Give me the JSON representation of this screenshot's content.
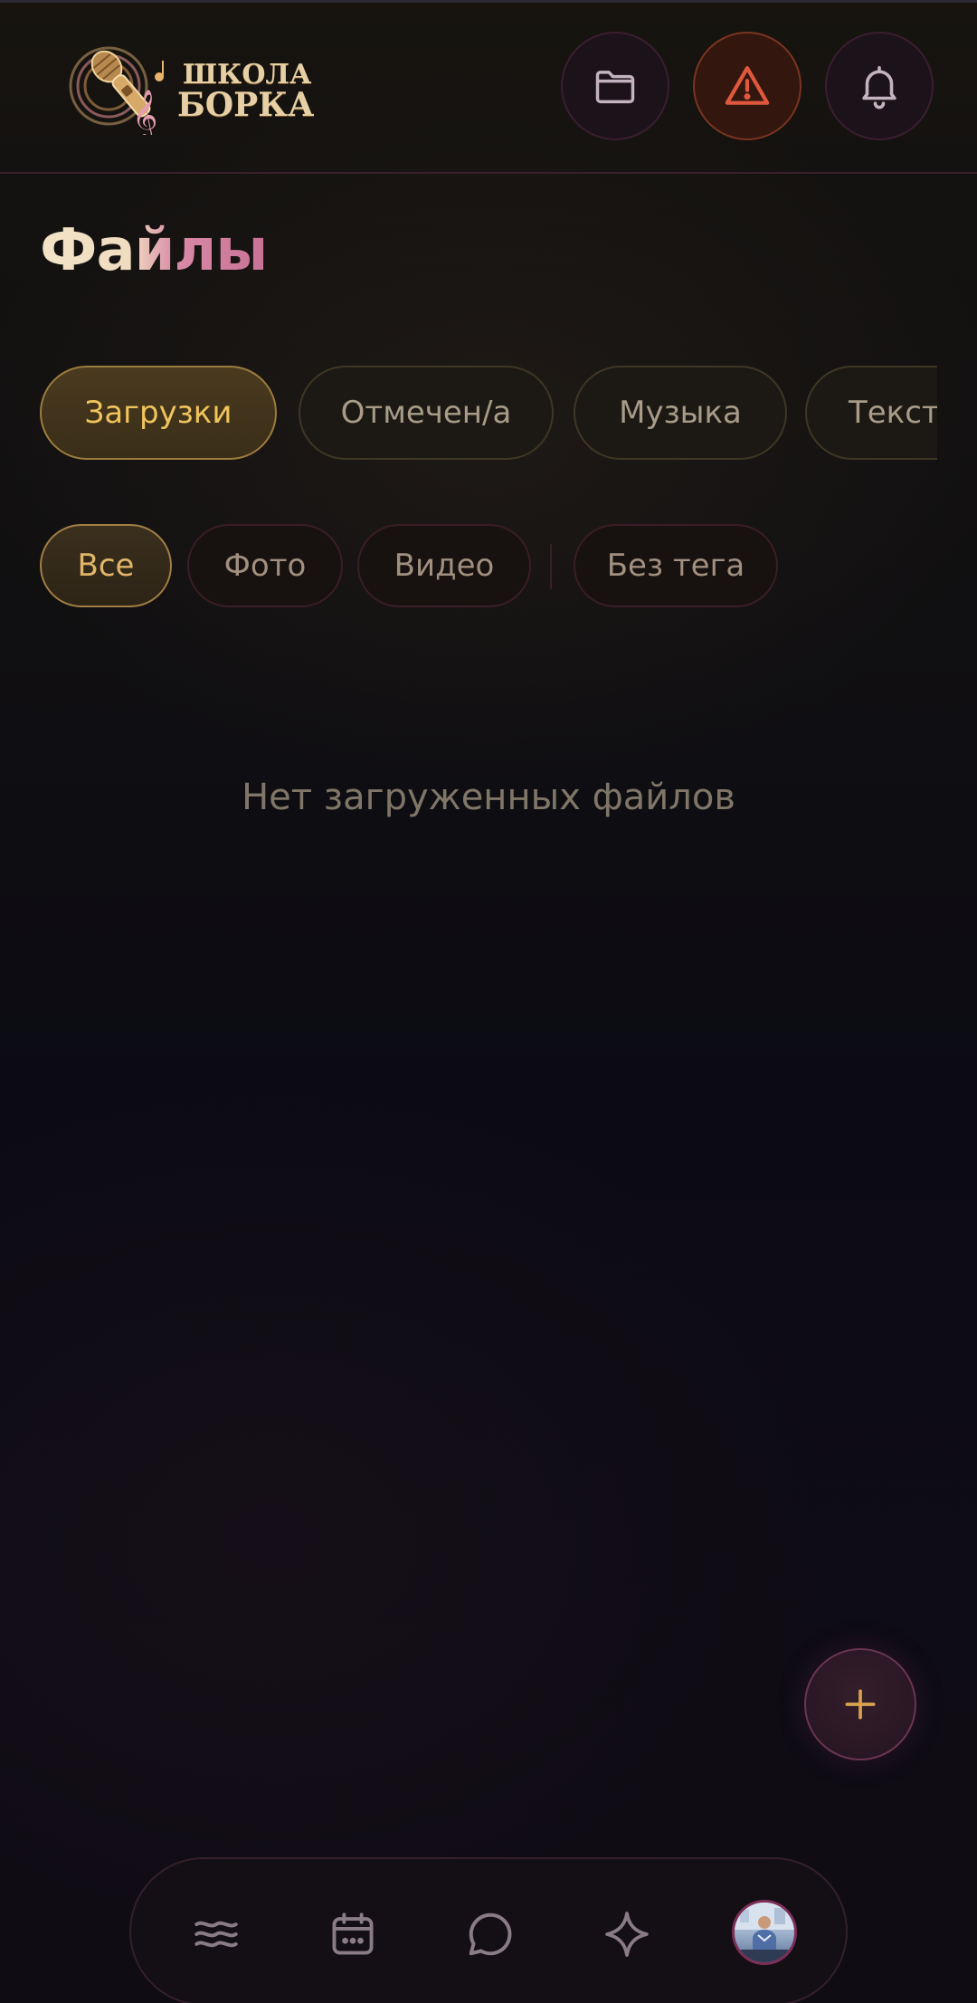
{
  "header": {
    "logo": {
      "line1": "ШКОЛА",
      "line2": "БОРКА"
    },
    "buttons": [
      {
        "icon": "folder-icon",
        "color": "#c3b2bf"
      },
      {
        "icon": "warning-icon",
        "color": "#e0583c"
      },
      {
        "icon": "bell-icon",
        "color": "#c3b2bf"
      }
    ]
  },
  "page": {
    "title": "Файлы"
  },
  "category_tabs": [
    {
      "label": "Загрузки",
      "active": true
    },
    {
      "label": "Отмечен/а",
      "active": false
    },
    {
      "label": "Музыка",
      "active": false
    },
    {
      "label": "Тексты",
      "active": false
    }
  ],
  "type_filters": [
    {
      "label": "Все",
      "active": true
    },
    {
      "label": "Фото",
      "active": false
    },
    {
      "label": "Видео",
      "active": false
    },
    {
      "label": "Без тега",
      "active": false
    }
  ],
  "empty_state": {
    "text": "Нет загруженных файлов"
  },
  "fab": {
    "icon": "plus-icon",
    "color": "#d9a24f"
  },
  "bottom_nav": {
    "items": [
      {
        "icon": "waves-icon"
      },
      {
        "icon": "calendar-icon"
      },
      {
        "icon": "chat-icon"
      },
      {
        "icon": "sparkle-icon"
      },
      {
        "icon": "avatar"
      }
    ],
    "icon_color": "#8a7c86"
  },
  "colors": {
    "accent_gold": "#f0c45c",
    "accent_pink": "#c76f94",
    "alert_orange": "#e0583c"
  }
}
